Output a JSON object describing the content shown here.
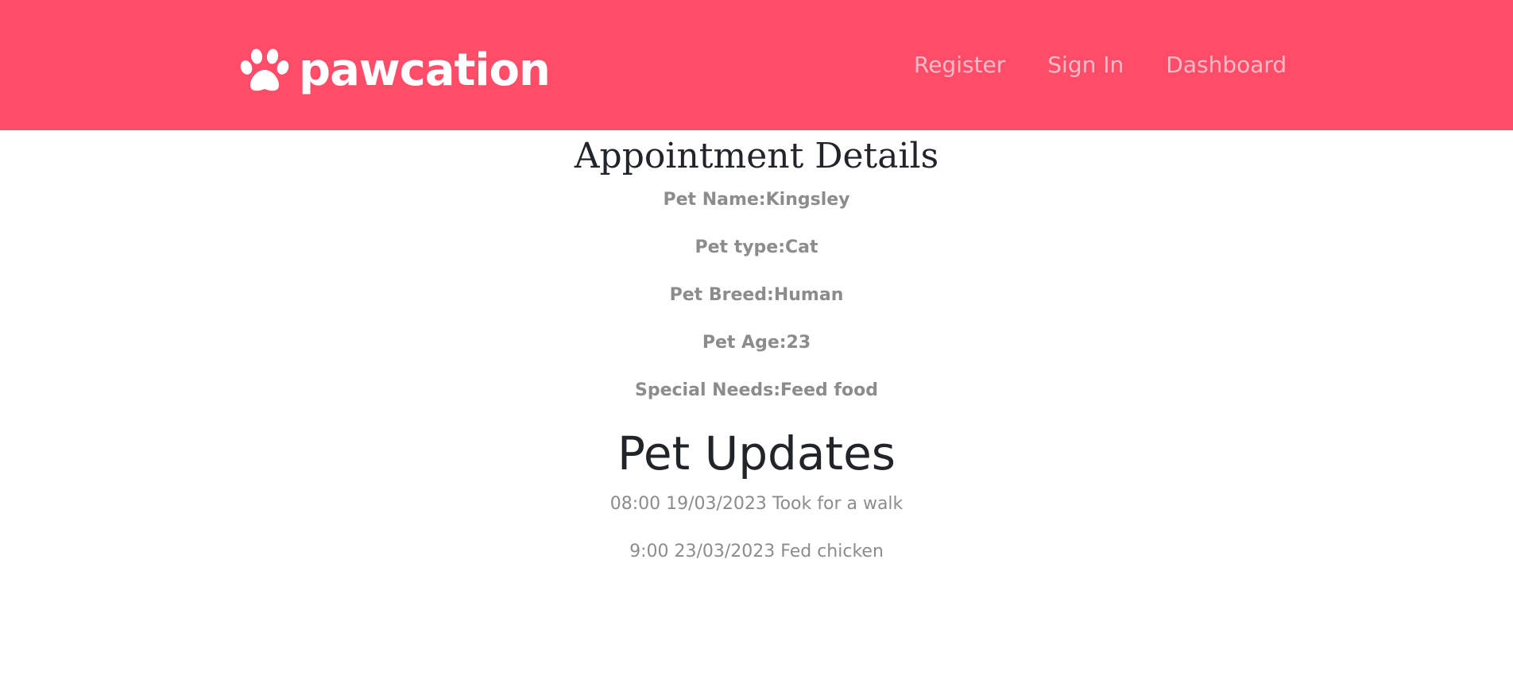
{
  "navbar": {
    "brand": "pawcation",
    "brand_icon": "paw-icon",
    "links": [
      "Register",
      "Sign In",
      "Dashboard"
    ],
    "colors": {
      "background": "#ff4c69",
      "text": "#ffffff"
    }
  },
  "appointment": {
    "title": "Appointment Details",
    "details": [
      "Pet Name:Kingsley",
      "Pet type:Cat",
      "Pet Breed:Human",
      "Pet Age:23",
      "Special Needs:Feed food"
    ]
  },
  "updates": {
    "title": "Pet Updates",
    "items": [
      "08:00 19/03/2023 Took for a walk",
      "9:00 23/03/2023 Fed chicken"
    ]
  }
}
